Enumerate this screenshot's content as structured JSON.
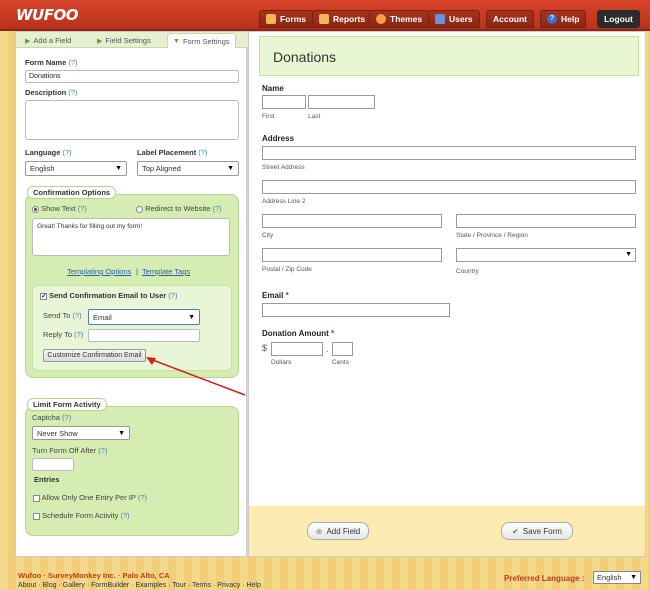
{
  "app": {
    "logo": "WUFOO"
  },
  "nav": {
    "forms": "Forms",
    "reports": "Reports",
    "themes": "Themes",
    "users": "Users",
    "account": "Account",
    "help": "Help",
    "logout": "Logout"
  },
  "tabs": {
    "add_field": "Add a Field",
    "field_settings": "Field Settings",
    "form_settings": "Form Settings"
  },
  "settings": {
    "form_name_label": "Form Name",
    "form_name_value": "Donations",
    "description_label": "Description",
    "language_label": "Language",
    "language_value": "English",
    "label_placement_label": "Label Placement",
    "label_placement_value": "Top Aligned",
    "help": "(?)"
  },
  "confirmation": {
    "title": "Confirmation Options",
    "show_text": "Show Text",
    "redirect": "Redirect to Website",
    "message": "Great! Thanks for filling out my form!",
    "templating_options": "Templating Options",
    "separator": "|",
    "template_tags": "Template Tags",
    "send_email_label": "Send Confirmation Email to User",
    "send_to_label": "Send To",
    "send_to_value": "Email",
    "reply_to_label": "Reply To",
    "customize_button": "Customize Confirmation Email"
  },
  "limit": {
    "title": "Limit Form Activity",
    "captcha_label": "Captcha",
    "captcha_value": "Never Show",
    "turn_off_label": "Turn Form Off After",
    "entries_label": "Entries",
    "one_entry": "Allow Only One Entry Per IP",
    "schedule": "Schedule Form Activity"
  },
  "form": {
    "title": "Donations",
    "name_label": "Name",
    "first": "First",
    "last": "Last",
    "address_label": "Address",
    "street": "Street Address",
    "line2": "Address Line 2",
    "city": "City",
    "state": "State / Province / Region",
    "zip": "Postal / Zip Code",
    "country": "Country",
    "email_label": "Email",
    "donation_label": "Donation Amount",
    "required_mark": "*",
    "currency": "$",
    "decimal": ".",
    "dollars": "Dollars",
    "cents": "Cents",
    "add_field_button": "Add Field",
    "save_button": "Save Form"
  },
  "footer": {
    "company": "Wufoo · SurveyMonkey Inc. · Palo Alto, CA",
    "links": "About · Blog · Gallery · FormBuilder · Examples · Tour · Terms · Privacy · Help",
    "preferred_language_label": "Preferred Language :",
    "preferred_language_value": "English"
  }
}
